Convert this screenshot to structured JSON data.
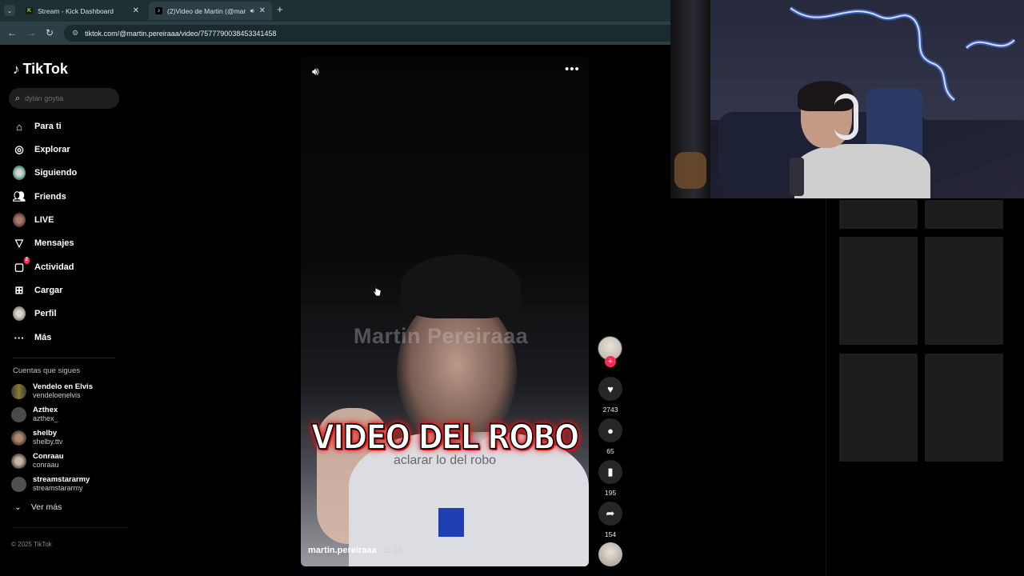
{
  "browser": {
    "tabs": [
      {
        "label": "Stream - Kick Dashboard",
        "favicon": "K",
        "active": false
      },
      {
        "label": "(2)Video de Martin (@marti",
        "favicon": "♪",
        "active": true
      }
    ],
    "url": "tiktok.com/@martin.pereiraaa/video/7577790038453341458"
  },
  "sidebar": {
    "logo": "TikTok",
    "search_placeholder": "dylan goytia",
    "nav": [
      {
        "label": "Para ti",
        "icon": "home-icon"
      },
      {
        "label": "Explorar",
        "icon": "compass-icon"
      },
      {
        "label": "Siguiendo",
        "icon": "following-avatar-icon"
      },
      {
        "label": "Friends",
        "icon": "friends-icon"
      },
      {
        "label": "LIVE",
        "icon": "live-avatar-icon"
      },
      {
        "label": "Mensajes",
        "icon": "messages-icon"
      },
      {
        "label": "Actividad",
        "icon": "activity-icon",
        "badge": "2"
      },
      {
        "label": "Cargar",
        "icon": "upload-icon"
      },
      {
        "label": "Perfil",
        "icon": "profile-avatar-icon"
      },
      {
        "label": "Más",
        "icon": "more-icon"
      }
    ],
    "following_title": "Cuentas que sigues",
    "following": [
      {
        "name": "Vendelo en Elvis",
        "handle": "vendeloenelvis"
      },
      {
        "name": "Azthex",
        "handle": "azthex_"
      },
      {
        "name": "shelby",
        "handle": "shelby.ttv"
      },
      {
        "name": "Conraau",
        "handle": "conraau"
      },
      {
        "name": "streamstararmy",
        "handle": "streamstararmy"
      }
    ],
    "see_more": "Ver más",
    "copyright": "© 2025 TikTok"
  },
  "video": {
    "watermark": "Martin Pereiraaa",
    "overlay_title": "VIDEO DEL ROBO",
    "overlay_subtitle": "aclarar lo del robo",
    "author": "martin.pereiraaa",
    "date": " · 11-28"
  },
  "actions": {
    "likes": "2743",
    "comments": "65",
    "saves": "195",
    "shares": "154"
  },
  "colors": {
    "accent": "#fe2c55",
    "title_glow": "#e01818"
  }
}
